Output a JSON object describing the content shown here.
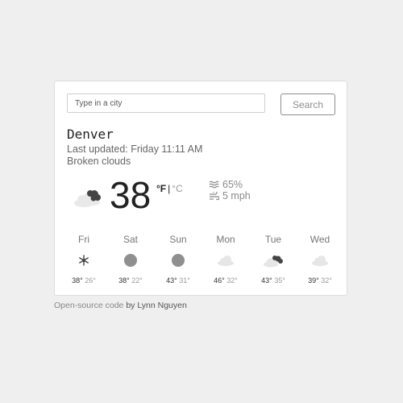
{
  "search": {
    "placeholder": "Type in a city",
    "button_label": "Search"
  },
  "current": {
    "city": "Denver",
    "updated": "Last updated: Friday 11:11 AM",
    "description": "Broken clouds",
    "temperature": "38",
    "unit_f": "°F",
    "unit_sep": "|",
    "unit_c": "°C",
    "humidity": "65%",
    "wind": "5 mph",
    "icon": "broken-clouds-icon"
  },
  "forecast": [
    {
      "day": "Fri",
      "high": "38°",
      "low": "26°",
      "icon": "snow-icon"
    },
    {
      "day": "Sat",
      "high": "38°",
      "low": "22°",
      "icon": "clear-icon"
    },
    {
      "day": "Sun",
      "high": "43°",
      "low": "31°",
      "icon": "clear-icon"
    },
    {
      "day": "Mon",
      "high": "46°",
      "low": "32°",
      "icon": "cloud-icon"
    },
    {
      "day": "Tue",
      "high": "43°",
      "low": "35°",
      "icon": "broken-clouds-icon"
    },
    {
      "day": "Wed",
      "high": "39°",
      "low": "32°",
      "icon": "cloud-icon"
    }
  ],
  "footer": {
    "prefix": "Open-source code",
    "author": "by Lynn Nguyen"
  }
}
